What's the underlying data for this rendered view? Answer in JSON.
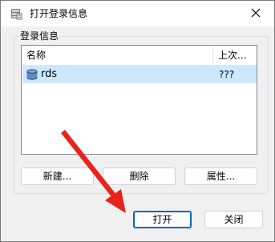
{
  "window": {
    "title": "打开登录信息",
    "icon": "database-icon",
    "close_icon": "close-icon"
  },
  "group": {
    "label": "登录信息"
  },
  "list": {
    "columns": [
      "名称",
      "上次..."
    ],
    "rows": [
      {
        "name": "rds",
        "last": "???",
        "icon": "database-icon",
        "selected": true
      }
    ]
  },
  "buttons": {
    "new": "新建...",
    "delete": "删除",
    "properties": "属性...",
    "open": "打开",
    "close": "关闭"
  },
  "colors": {
    "selection": "#cce8ff",
    "default_button_border": "#0067c0",
    "annotation_arrow": "#e8231b"
  }
}
